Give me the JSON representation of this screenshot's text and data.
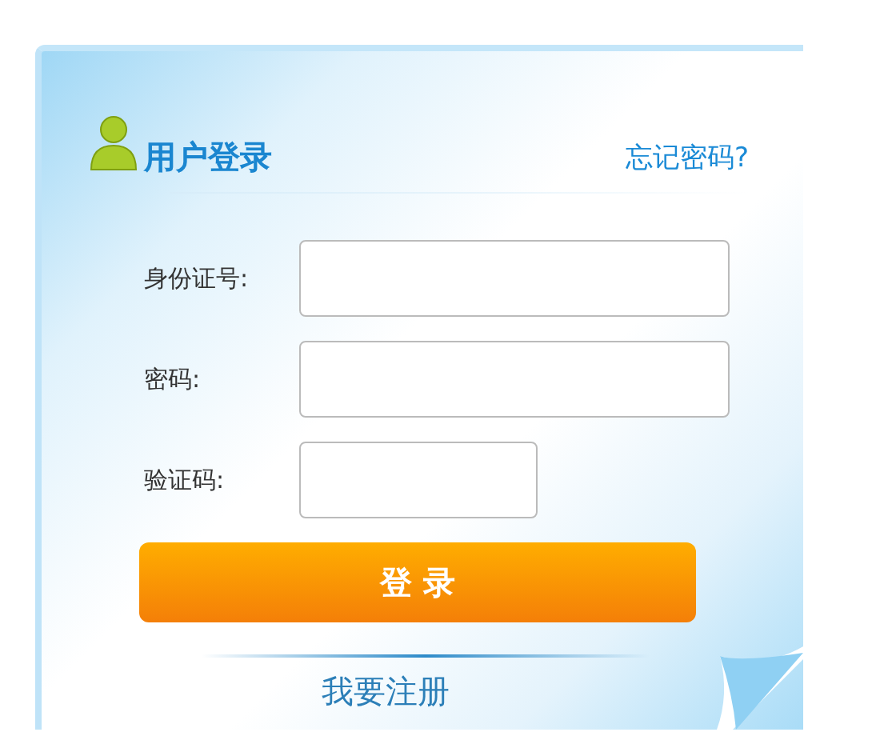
{
  "title": "用户登录",
  "forgot_link": "忘记密码?",
  "fields": [
    {
      "label": "身份证号:",
      "kind": "wide"
    },
    {
      "label": "密码:",
      "kind": "wide"
    },
    {
      "label": "验证码:",
      "kind": "short"
    }
  ],
  "submit_button": "登 录",
  "register_link": "我要注册"
}
